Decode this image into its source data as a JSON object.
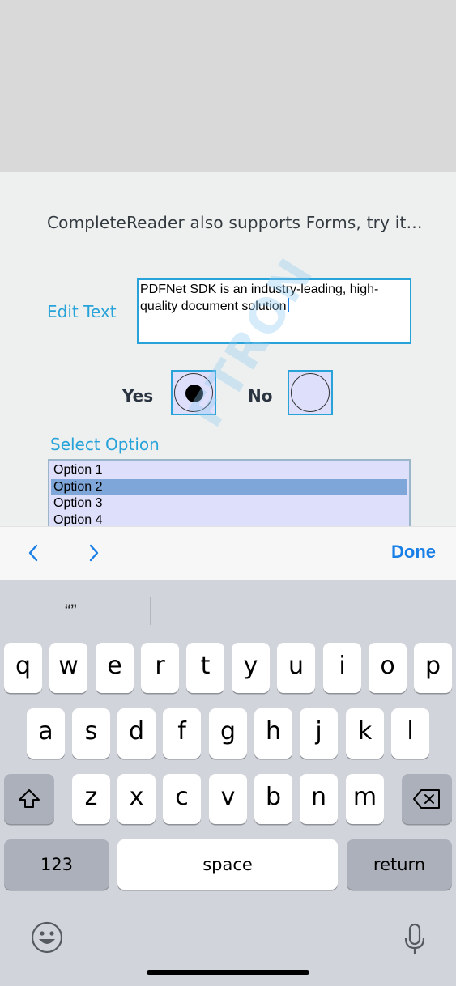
{
  "form": {
    "intro_text": "CompleteReader also supports Forms, try it…",
    "edit_label": "Edit Text",
    "text_value": "PDFNet SDK is an industry-leading, high-quality document solution",
    "text_line1": "PDFNet SDK is an industry-leading, high-",
    "text_line2": "quality document solution",
    "radio_yes_label": "Yes",
    "radio_no_label": "No",
    "radio_selected": "Yes",
    "select_label": "Select Option",
    "options": [
      "Option 1",
      "Option 2",
      "Option 3",
      "Option 4"
    ],
    "selected_option": "Option 2",
    "watermark": "FTRON"
  },
  "accessory_bar": {
    "prev_icon": "chevron-left-icon",
    "next_icon": "chevron-right-icon",
    "done_label": "Done"
  },
  "keyboard": {
    "suggestions": [
      "“”",
      "",
      ""
    ],
    "row1": [
      "q",
      "w",
      "e",
      "r",
      "t",
      "y",
      "u",
      "i",
      "o",
      "p"
    ],
    "row2": [
      "a",
      "s",
      "d",
      "f",
      "g",
      "h",
      "j",
      "k",
      "l"
    ],
    "row3": [
      "z",
      "x",
      "c",
      "v",
      "b",
      "n",
      "m"
    ],
    "shift_icon": "shift-icon",
    "delete_icon": "delete-icon",
    "numbers_label": "123",
    "space_label": "space",
    "return_label": "return",
    "emoji_icon": "emoji-icon",
    "mic_icon": "microphone-icon"
  },
  "colors": {
    "accent": "#27a3d9",
    "ios_blue": "#1a7fe6",
    "field_fill": "#dedffb",
    "selected_option": "#7ea6d8",
    "keyboard_bg": "#d1d4db"
  }
}
